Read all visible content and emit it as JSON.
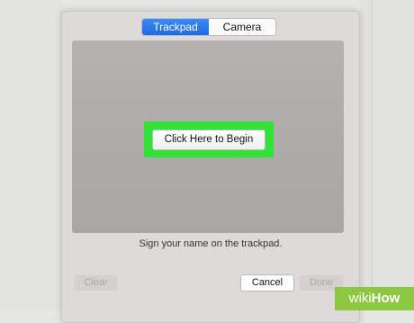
{
  "tabs": [
    {
      "label": "Trackpad",
      "active": true
    },
    {
      "label": "Camera",
      "active": false
    }
  ],
  "pad": {
    "begin_label": "Click Here to Begin",
    "highlight_color": "#30e336"
  },
  "instruction": "Sign your name on the trackpad.",
  "footer": {
    "clear_label": "Clear",
    "cancel_label": "Cancel",
    "done_label": "Done"
  },
  "watermark": {
    "wiki": "wiki",
    "how": "How",
    "color": "#8dc640"
  }
}
